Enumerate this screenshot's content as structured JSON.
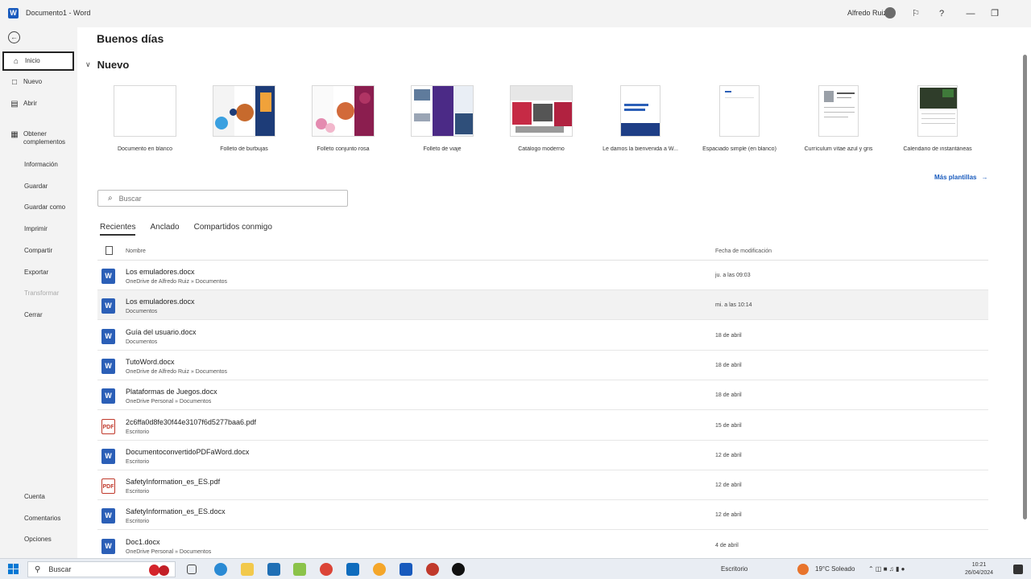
{
  "titlebar": {
    "title": "Documento1 - Word",
    "user": "Alfredo Ruiz",
    "help": "?",
    "minimize": "—",
    "restore": "❐"
  },
  "sidebar": {
    "back": "←",
    "items": [
      {
        "label": "Inicio",
        "icon": "⌂"
      },
      {
        "label": "Nuevo",
        "icon": "□"
      },
      {
        "label": "Abrir",
        "icon": "▤"
      },
      {
        "label": "Obtener complementos",
        "icon": "▦"
      }
    ],
    "plain": [
      "Información",
      "Guardar",
      "Guardar como",
      "Imprimir",
      "Compartir",
      "Exportar",
      "Transformar",
      "Cerrar"
    ],
    "bottom": [
      "Cuenta",
      "Comentarios",
      "Opciones"
    ]
  },
  "main": {
    "greeting": "Buenos días",
    "new_section": "Nuevo",
    "templates": [
      {
        "name": "Documento en blanco"
      },
      {
        "name": "Folleto de burbujas"
      },
      {
        "name": "Folleto conjunto rosa"
      },
      {
        "name": "Folleto de viaje"
      },
      {
        "name": "Catálogo moderno"
      },
      {
        "name": "Le damos la bienvenida a W..."
      },
      {
        "name": "Espaciado simple (en blanco)"
      },
      {
        "name": "Currículum vítae azul y gris"
      },
      {
        "name": "Calendario de instantáneas"
      }
    ],
    "more_templates": "Más plantillas",
    "more_arrow": "→",
    "search": {
      "placeholder": "Buscar",
      "icon": "⌕"
    },
    "tabs": [
      "Recientes",
      "Anclado",
      "Compartidos conmigo"
    ],
    "list": {
      "col_name": "Nombre",
      "col_date": "Fecha de modificación",
      "rows": [
        {
          "name": "Los emuladores.docx",
          "path": "OneDrive de Alfredo Ruiz » Documentos",
          "date": "ju. a las 09:03",
          "type": "word"
        },
        {
          "name": "Los emuladores.docx",
          "path": "Documentos",
          "date": "mi. a las 10:14",
          "type": "word"
        },
        {
          "name": "Guía del usuario.docx",
          "path": "Documentos",
          "date": "18 de abril",
          "type": "word"
        },
        {
          "name": "TutoWord.docx",
          "path": "OneDrive de Alfredo Ruiz » Documentos",
          "date": "18 de abril",
          "type": "word"
        },
        {
          "name": "Plataformas de Juegos.docx",
          "path": "OneDrive Personal » Documentos",
          "date": "18 de abril",
          "type": "word"
        },
        {
          "name": "2c6ffa0d8fe30f44e3107f6d5277baa6.pdf",
          "path": "Escritorio",
          "date": "15 de abril",
          "type": "pdf"
        },
        {
          "name": "DocumentoconvertidoPDFaWord.docx",
          "path": "Escritorio",
          "date": "12 de abril",
          "type": "word"
        },
        {
          "name": "SafetyInformation_es_ES.pdf",
          "path": "Escritorio",
          "date": "12 de abril",
          "type": "pdf"
        },
        {
          "name": "SafetyInformation_es_ES.docx",
          "path": "Escritorio",
          "date": "12 de abril",
          "type": "word"
        },
        {
          "name": "Doc1.docx",
          "path": "OneDrive Personal » Documentos",
          "date": "4 de abril",
          "type": "word"
        }
      ]
    }
  },
  "taskbar": {
    "search": "Buscar",
    "desktop": "Escritorio",
    "weather": "19°C  Soleado",
    "time": "10:21",
    "date": "26/04/2024"
  }
}
